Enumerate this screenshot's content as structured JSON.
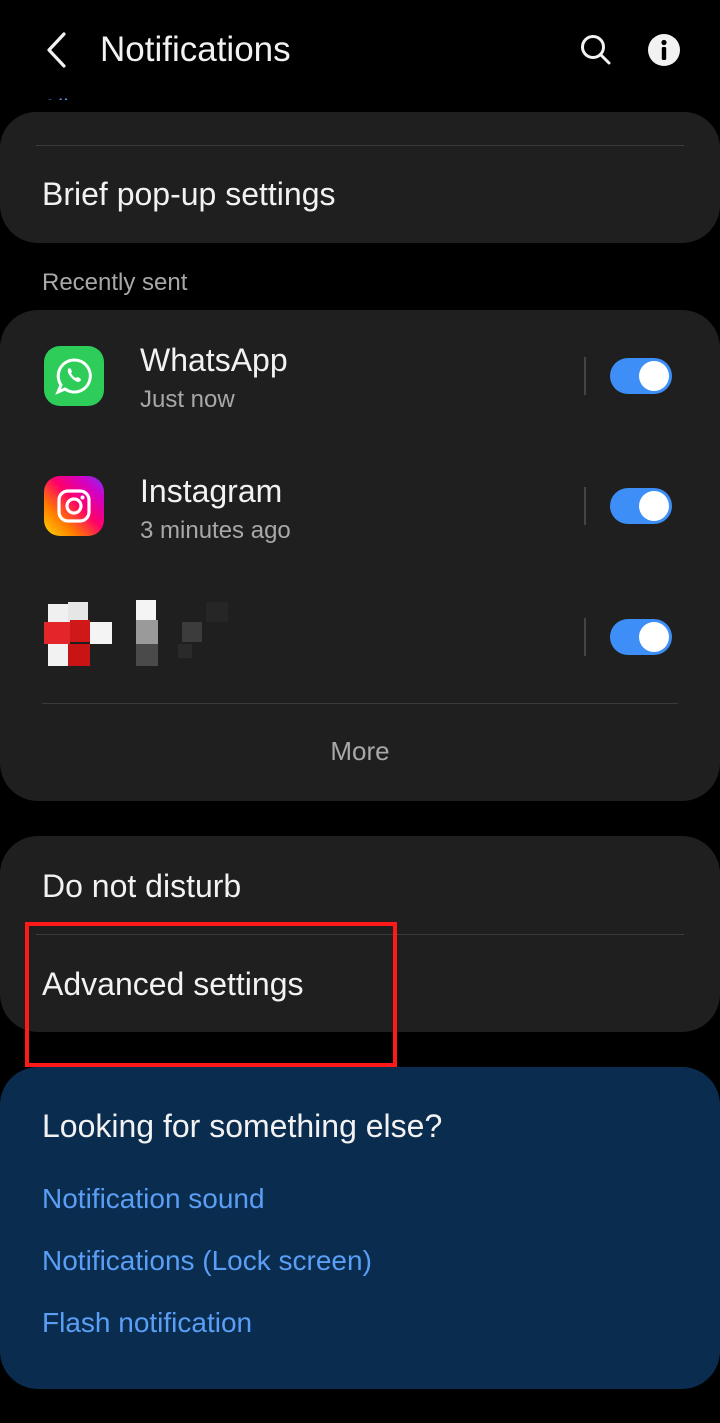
{
  "header": {
    "title": "Notifications",
    "back_icon": "back-arrow-icon",
    "search_icon": "search-icon",
    "info_icon": "info-icon"
  },
  "top_card": {
    "cut_link": "All apps",
    "brief_popup": "Brief pop-up settings"
  },
  "recent": {
    "section_label": "Recently sent",
    "apps": [
      {
        "name": "WhatsApp",
        "time": "Just now",
        "enabled": true
      },
      {
        "name": "Instagram",
        "time": "3 minutes ago",
        "enabled": true
      },
      {
        "name": "",
        "time": "",
        "enabled": true
      }
    ],
    "more": "More"
  },
  "settings": {
    "do_not_disturb": "Do not disturb",
    "advanced": "Advanced settings"
  },
  "looking": {
    "title": "Looking for something else?",
    "links": [
      "Notification sound",
      "Notifications (Lock screen)",
      "Flash notification"
    ]
  },
  "colors": {
    "accent": "#3e8ef7",
    "link": "#5a9ef5",
    "highlight": "#ff1a1a",
    "card": "#1f1f1f",
    "suggest_bg": "#0a2c4e"
  }
}
